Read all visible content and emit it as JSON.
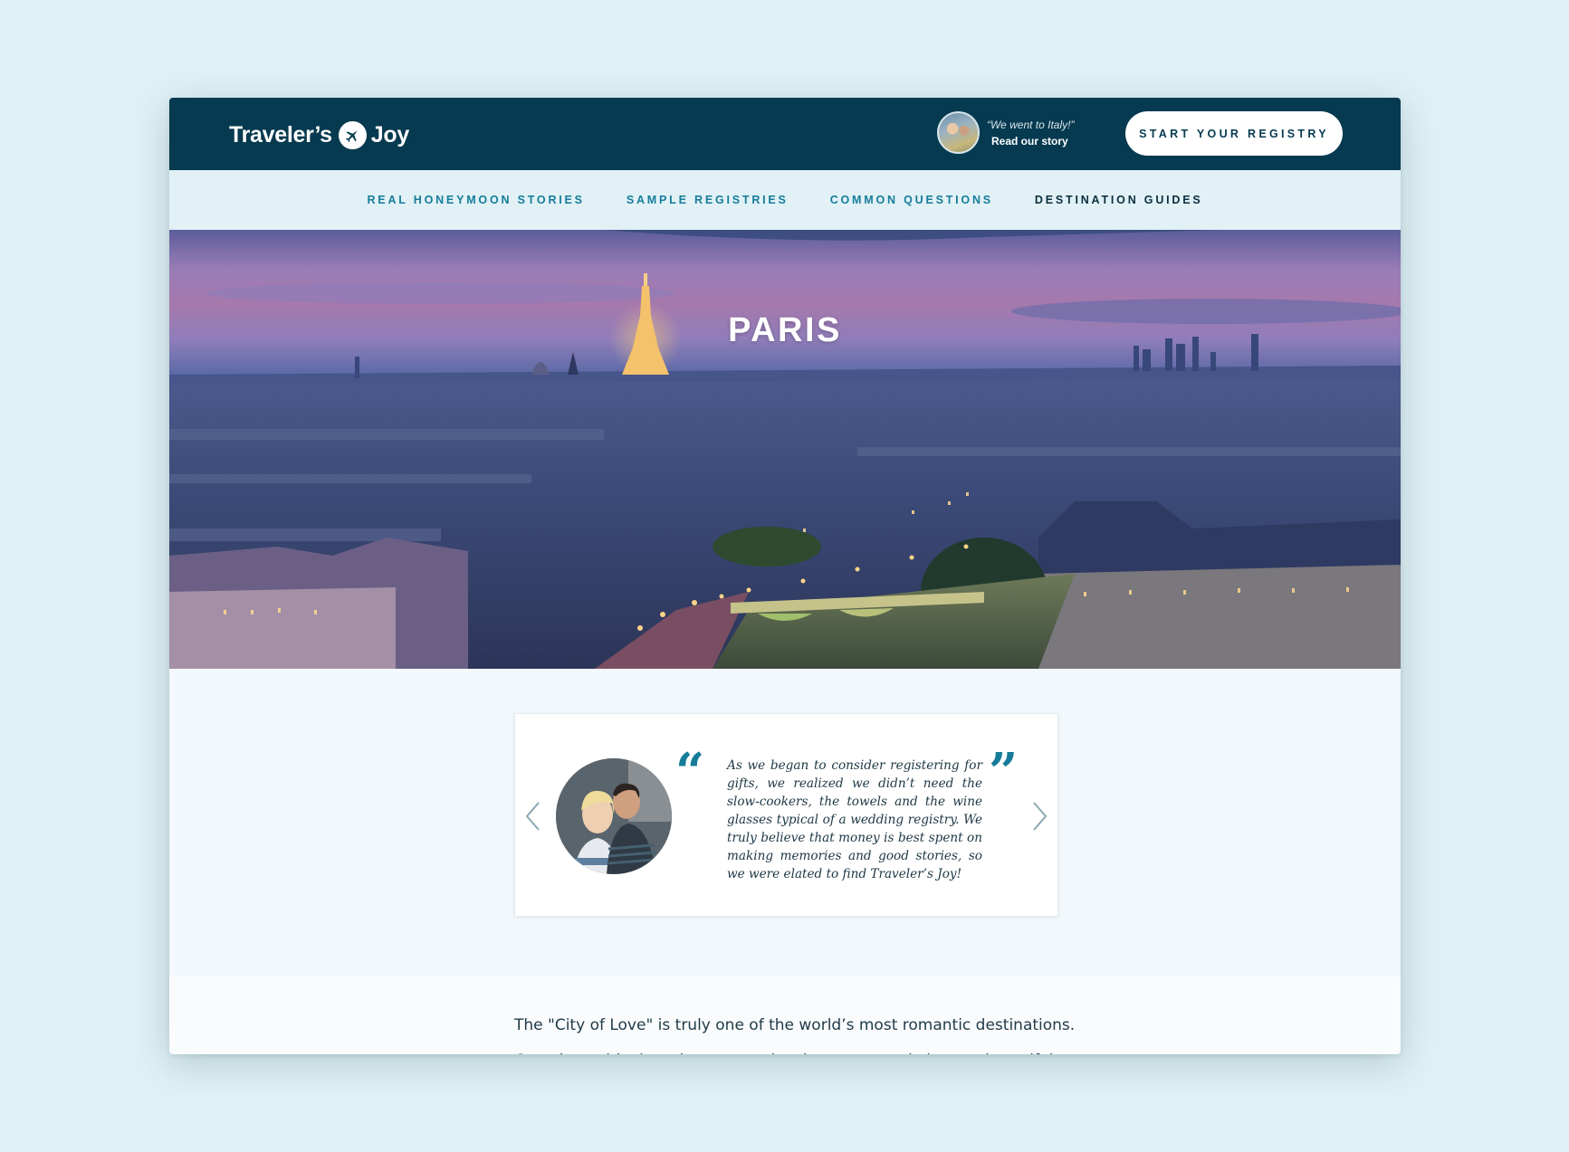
{
  "brand": {
    "logo_left": "Traveler’s",
    "logo_right": "Joy"
  },
  "header": {
    "story_quote": "“We went to Italy!”",
    "story_link": "Read our story",
    "cta_label": "START YOUR REGISTRY"
  },
  "nav": {
    "items": [
      {
        "label": "REAL HONEYMOON STORIES"
      },
      {
        "label": "SAMPLE REGISTRIES"
      },
      {
        "label": "COMMON QUESTIONS"
      },
      {
        "label": "DESTINATION GUIDES"
      }
    ],
    "active": "DESTINATION GUIDES"
  },
  "hero": {
    "title": "PARIS"
  },
  "testimonial": {
    "quote": "As we began to consider registering for gifts, we realized we didn’t need the slow-cookers, the towels and the wine glasses typical of a wedding registry. We truly believe that money is best spent on making memories and good stories, so we were elated to find Traveler’s Joy!"
  },
  "content": {
    "paragraph_line1": "The \"City of Love\" is truly one of the world’s most romantic destinations.",
    "paragraph_line2": "Complete with charming streets, iconic streets, and views ... beautiful"
  },
  "colors": {
    "header_bg": "#063a50",
    "nav_bg": "#e1f1f6",
    "nav_link": "#167c99",
    "nav_active": "#0d2f3e",
    "accent": "#167c99",
    "page_bg": "#dff1f5"
  },
  "icons": {
    "logo_mark": "airplane-icon",
    "prev": "chevron-left-icon",
    "next": "chevron-right-icon",
    "open_quote": "open-quote-icon",
    "close_quote": "close-quote-icon"
  }
}
